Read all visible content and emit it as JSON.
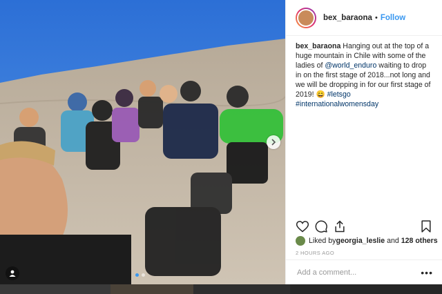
{
  "post": {
    "username": "bex_baraona",
    "separator": "•",
    "follow_label": "Follow",
    "caption_user": "bex_baraona",
    "caption_p1": " Hanging out at the top of a huge mountain in Chile with some of the ladies of ",
    "caption_mention": "@world_enduro",
    "caption_p2": " waiting to drop in on the first stage of 2018...not long and we will be dropping in for our first stage of 2019! 😄 ",
    "hashtag1": "#letsgo",
    "hashtag2": "#internationalwomensday",
    "likes_prefix": "Liked by ",
    "liked_by": "georgia_leslie",
    "likes_middle": " and ",
    "likes_others": "128 others",
    "time": "2 HOURS AGO",
    "comment_placeholder": "Add a comment...",
    "more_label": "•••"
  },
  "carousel": {
    "slide_count": 2,
    "active_slide": 1
  },
  "icons": {
    "like": "heart-icon",
    "comment": "comment-icon",
    "share": "share-icon",
    "save": "bookmark-icon",
    "next": "chevron-right-icon",
    "user_tag": "user-tag-icon"
  },
  "colors": {
    "link": "#3897f0",
    "hashtag": "#003569",
    "text": "#262626",
    "muted": "#999999"
  }
}
